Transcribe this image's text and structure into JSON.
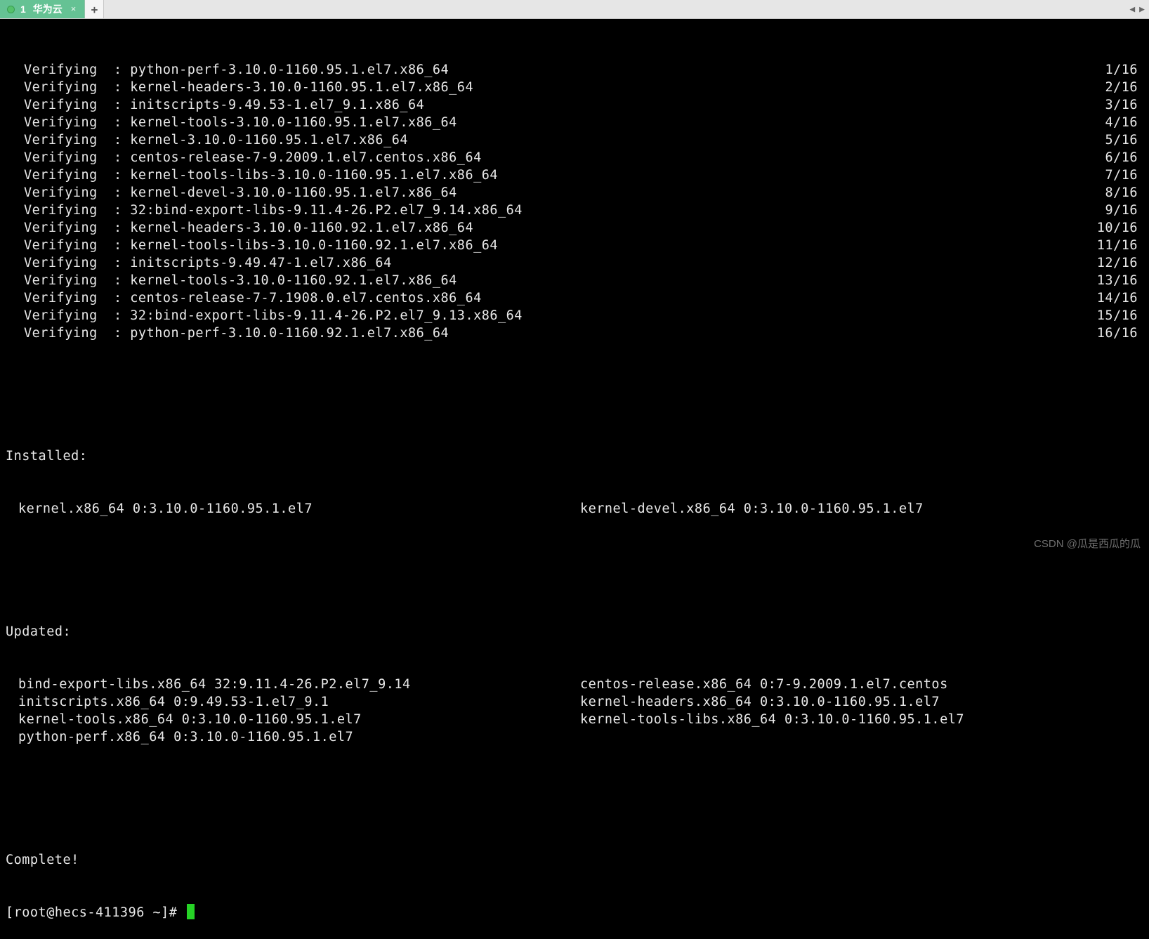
{
  "tabs": {
    "active": {
      "index": "1",
      "label": "华为云"
    },
    "add": "+",
    "navLeft": "◀",
    "navRight": "▶"
  },
  "term": {
    "verifyWord": "Verifying",
    "sep": "  : ",
    "verifying": [
      {
        "pkg": "python-perf-3.10.0-1160.95.1.el7.x86_64",
        "pos": "1/16"
      },
      {
        "pkg": "kernel-headers-3.10.0-1160.95.1.el7.x86_64",
        "pos": "2/16"
      },
      {
        "pkg": "initscripts-9.49.53-1.el7_9.1.x86_64",
        "pos": "3/16"
      },
      {
        "pkg": "kernel-tools-3.10.0-1160.95.1.el7.x86_64",
        "pos": "4/16"
      },
      {
        "pkg": "kernel-3.10.0-1160.95.1.el7.x86_64",
        "pos": "5/16"
      },
      {
        "pkg": "centos-release-7-9.2009.1.el7.centos.x86_64",
        "pos": "6/16"
      },
      {
        "pkg": "kernel-tools-libs-3.10.0-1160.95.1.el7.x86_64",
        "pos": "7/16"
      },
      {
        "pkg": "kernel-devel-3.10.0-1160.95.1.el7.x86_64",
        "pos": "8/16"
      },
      {
        "pkg": "32:bind-export-libs-9.11.4-26.P2.el7_9.14.x86_64",
        "pos": "9/16"
      },
      {
        "pkg": "kernel-headers-3.10.0-1160.92.1.el7.x86_64",
        "pos": "10/16"
      },
      {
        "pkg": "kernel-tools-libs-3.10.0-1160.92.1.el7.x86_64",
        "pos": "11/16"
      },
      {
        "pkg": "initscripts-9.49.47-1.el7.x86_64",
        "pos": "12/16"
      },
      {
        "pkg": "kernel-tools-3.10.0-1160.92.1.el7.x86_64",
        "pos": "13/16"
      },
      {
        "pkg": "centos-release-7-7.1908.0.el7.centos.x86_64",
        "pos": "14/16"
      },
      {
        "pkg": "32:bind-export-libs-9.11.4-26.P2.el7_9.13.x86_64",
        "pos": "15/16"
      },
      {
        "pkg": "python-perf-3.10.0-1160.92.1.el7.x86_64",
        "pos": "16/16"
      }
    ],
    "installedHdr": "Installed:",
    "installed": [
      {
        "c1": "kernel.x86_64 0:3.10.0-1160.95.1.el7",
        "c2": "kernel-devel.x86_64 0:3.10.0-1160.95.1.el7"
      }
    ],
    "updatedHdr": "Updated:",
    "updated": [
      {
        "c1": "bind-export-libs.x86_64 32:9.11.4-26.P2.el7_9.14",
        "c2": "centos-release.x86_64 0:7-9.2009.1.el7.centos"
      },
      {
        "c1": "initscripts.x86_64 0:9.49.53-1.el7_9.1",
        "c2": "kernel-headers.x86_64 0:3.10.0-1160.95.1.el7"
      },
      {
        "c1": "kernel-tools.x86_64 0:3.10.0-1160.95.1.el7",
        "c2": "kernel-tools-libs.x86_64 0:3.10.0-1160.95.1.el7"
      },
      {
        "c1": "python-perf.x86_64 0:3.10.0-1160.95.1.el7",
        "c2": ""
      }
    ],
    "complete": "Complete!",
    "prompt": "[root@hecs-411396 ~]# "
  },
  "watermark": "CSDN @瓜是西瓜的瓜"
}
